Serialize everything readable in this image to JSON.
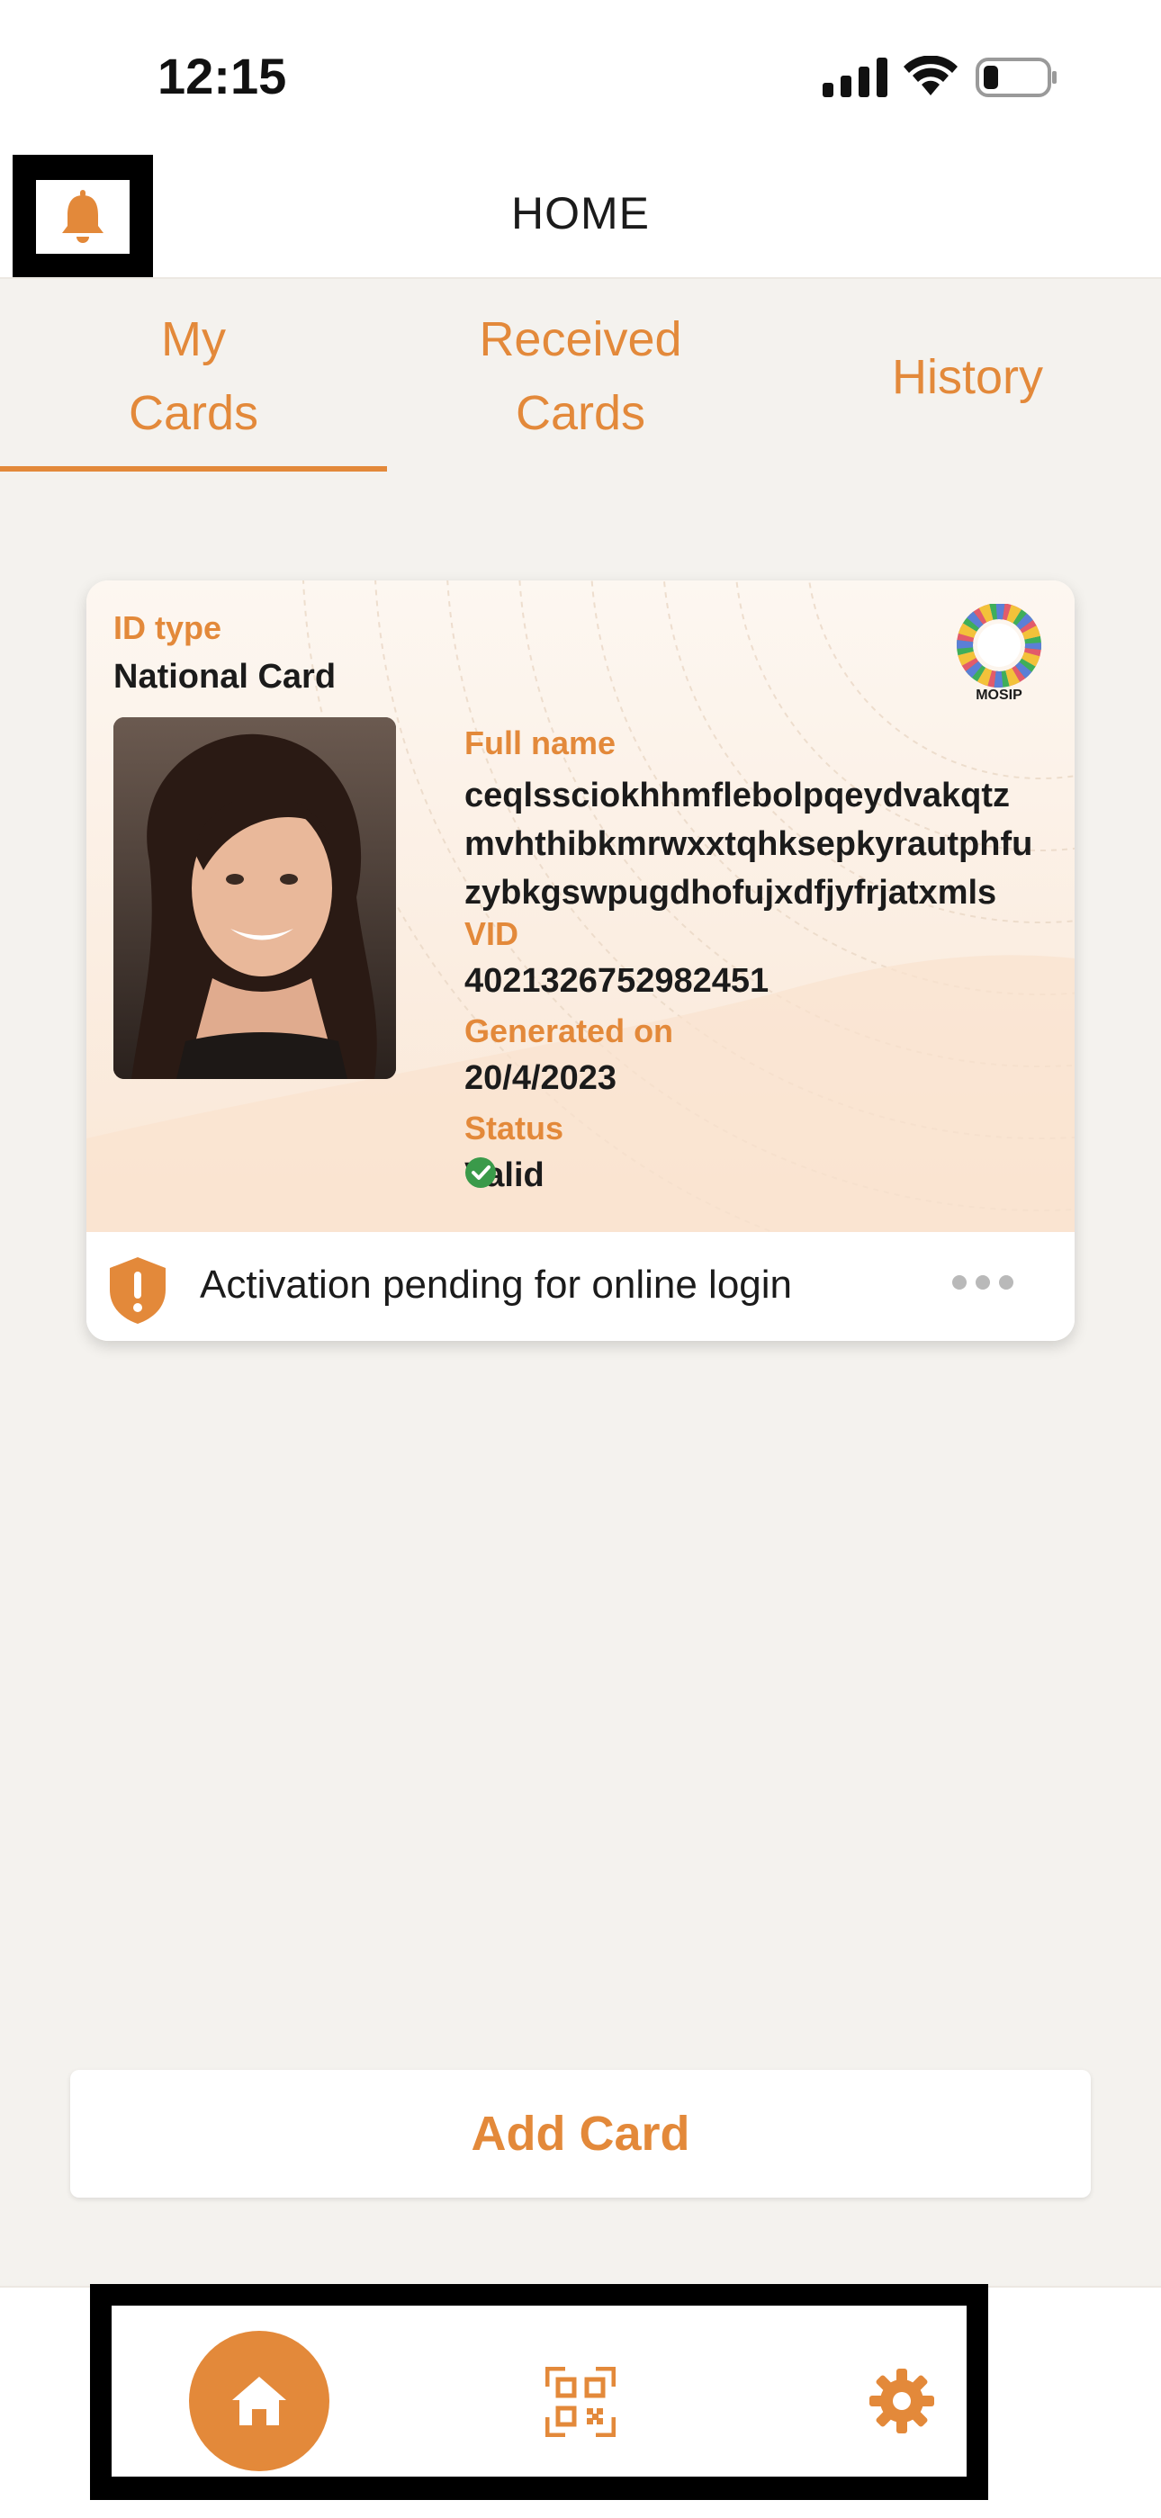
{
  "status_bar": {
    "time": "12:15"
  },
  "header": {
    "title": "HOME",
    "bell_icon": "bell-icon"
  },
  "tabs": [
    {
      "line1": "My",
      "line2": "Cards",
      "active": true
    },
    {
      "line1": "Received",
      "line2": "Cards",
      "active": false
    },
    {
      "line1": "History",
      "active": false
    }
  ],
  "card": {
    "id_type_label": "ID type",
    "id_type_value": "National Card",
    "logo_text": "MOSIP",
    "full_name_label": "Full name",
    "full_name_lines": [
      "ceqlssciokhhmflebolpqeydvakqtz",
      "mvhthibkmrwxxtqhksepkyrautphfu",
      "zybkgswpugdhofujxdfjyfrjatxmls"
    ],
    "vid_label": "VID",
    "vid_value": "4021326752982451",
    "generated_on_label": "Generated on",
    "generated_on_value": "20/4/2023",
    "status_label": "Status",
    "status_value": "Valid",
    "activation_text": "Activation pending for online login"
  },
  "add_card_label": "Add Card",
  "colors": {
    "accent": "#e3893a",
    "valid": "#3a9a4a",
    "background": "#f4f2ee"
  },
  "nav": {
    "items": [
      "home-icon",
      "qr-scan-icon",
      "settings-icon"
    ]
  }
}
